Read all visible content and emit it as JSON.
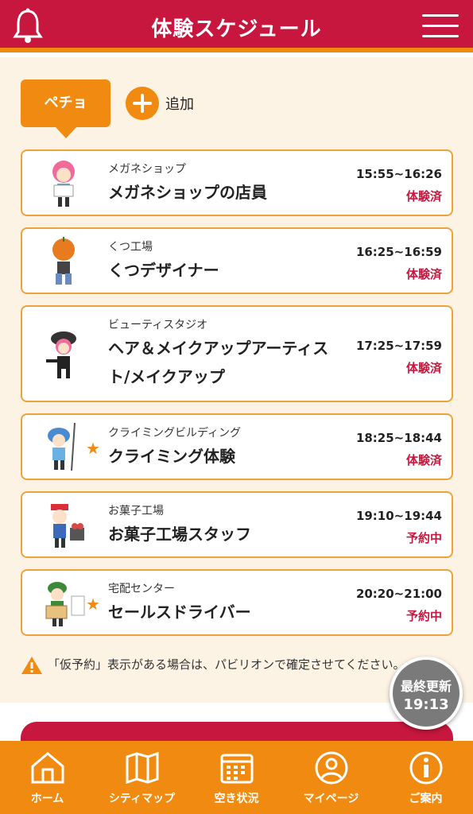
{
  "header": {
    "title": "体験スケジュール",
    "bell_icon": "bell-icon",
    "menu_icon": "hamburger-menu-icon"
  },
  "tabs": {
    "active_label": "ペチョ",
    "add_label": "追加"
  },
  "schedule": [
    {
      "place": "メガネショップ",
      "job": "メガネショップの店員",
      "time": "15:55~16:26",
      "status": "体験済",
      "star": false
    },
    {
      "place": "くつ工場",
      "job": "くつデザイナー",
      "time": "16:25~16:59",
      "status": "体験済",
      "star": false
    },
    {
      "place": "ビューティスタジオ",
      "job": "ヘア＆メイクアップアーティスト/メイクアップ",
      "job_line1": "ヘア＆メイクアップアーティス",
      "job_line2": "ト/メイクアップ",
      "time": "17:25~17:59",
      "status": "体験済",
      "star": false
    },
    {
      "place": "クライミングビルディング",
      "job": "クライミング体験",
      "time": "18:25~18:44",
      "status": "体験済",
      "star": true
    },
    {
      "place": "お菓子工場",
      "job": "お菓子工場スタッフ",
      "time": "19:10~19:44",
      "status": "予約中",
      "star": false
    },
    {
      "place": "宅配センター",
      "job": "セールスドライバー",
      "time": "20:20~21:00",
      "status": "予約中",
      "star": true
    }
  ],
  "notice": {
    "text": "「仮予約」表示がある場合は、パビリオンで確定させてください。"
  },
  "update": {
    "label": "最終更新",
    "time": "19:13"
  },
  "footer": [
    {
      "label": "ホーム",
      "icon": "home-icon"
    },
    {
      "label": "シティマップ",
      "icon": "map-icon"
    },
    {
      "label": "空き状況",
      "icon": "calendar-icon"
    },
    {
      "label": "マイページ",
      "icon": "user-icon"
    },
    {
      "label": "ご案内",
      "icon": "info-icon"
    }
  ],
  "colors": {
    "brand_red": "#c8173e",
    "accent_orange": "#f08a10",
    "background_cream": "#fdf3e5"
  }
}
